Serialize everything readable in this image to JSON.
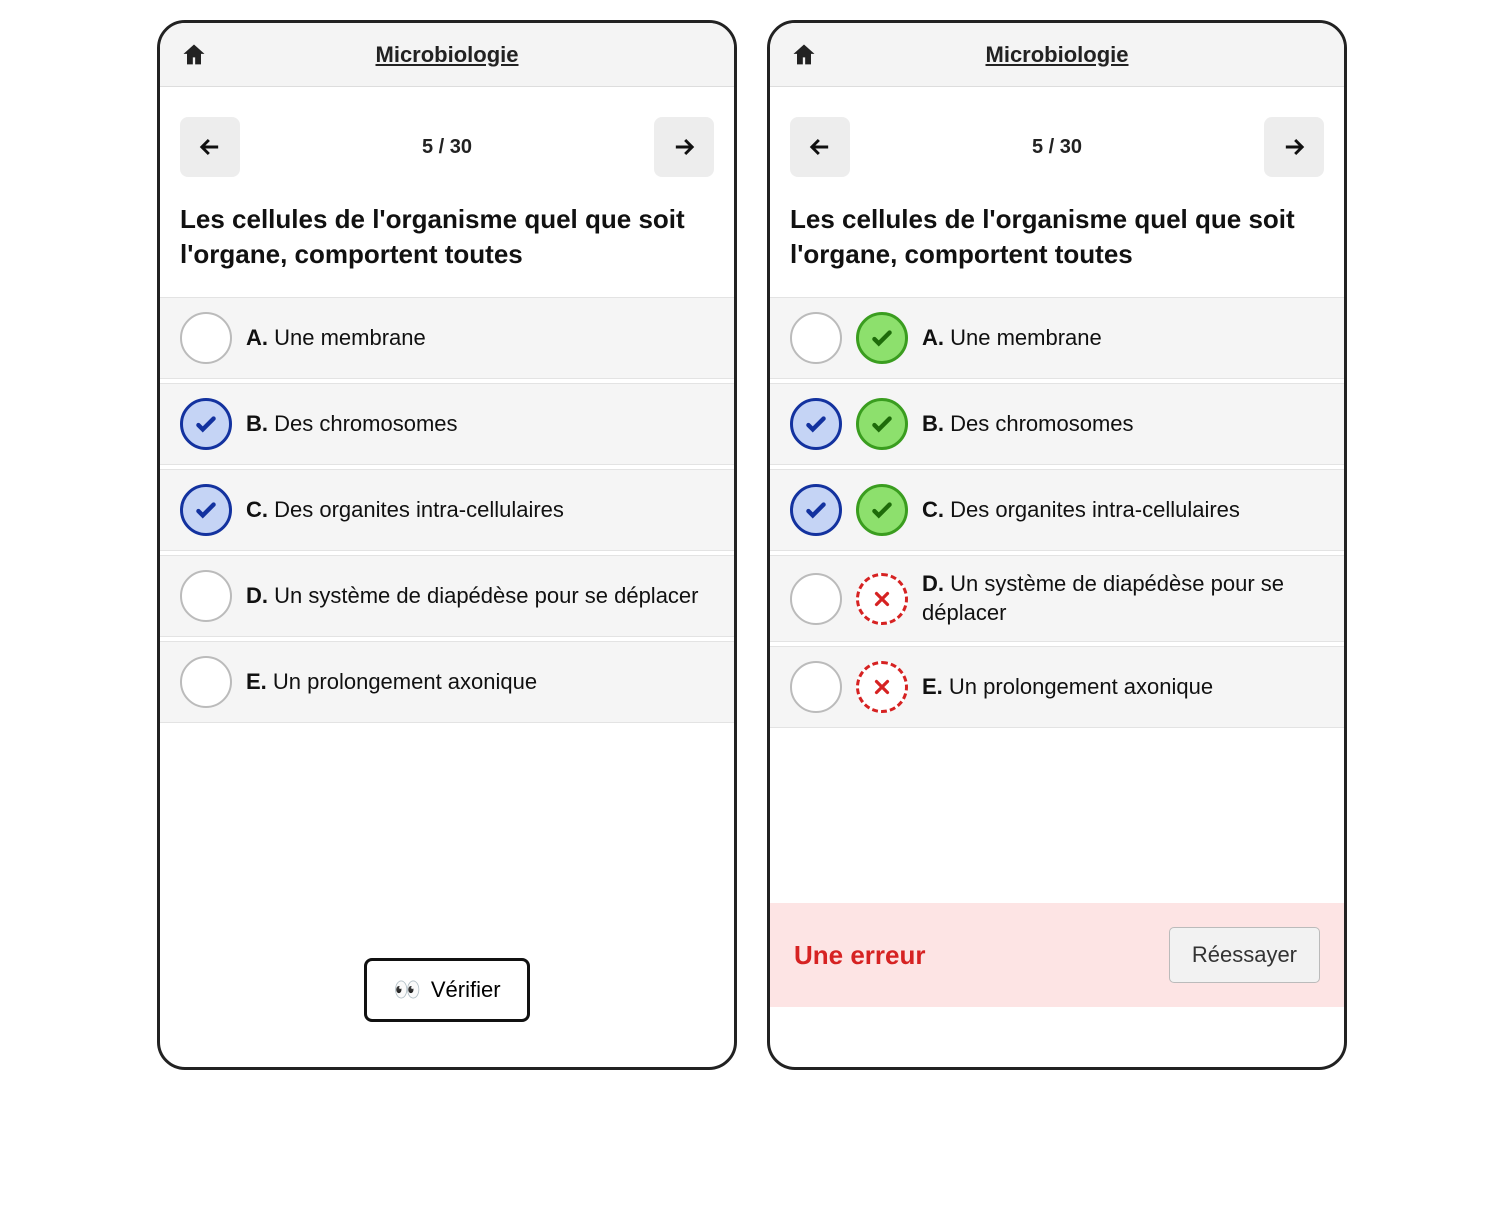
{
  "header": {
    "title": "Microbiologie"
  },
  "nav": {
    "counter": "5 / 30"
  },
  "question": "Les cellules de l'organisme quel que soit l'organe, comportent toutes",
  "options": [
    {
      "letter": "A.",
      "text": "Une membrane",
      "selected": false,
      "correct": true
    },
    {
      "letter": "B.",
      "text": "Des chromosomes",
      "selected": true,
      "correct": true
    },
    {
      "letter": "C.",
      "text": "Des organites intra-cellulaires",
      "selected": true,
      "correct": true
    },
    {
      "letter": "D.",
      "text": "Un système de diapédèse pour se déplacer",
      "selected": false,
      "correct": false
    },
    {
      "letter": "E.",
      "text": "Un prolongement axonique",
      "selected": false,
      "correct": false
    }
  ],
  "buttons": {
    "verify": "Vérifier",
    "verify_emoji": "👀",
    "retry": "Réessayer"
  },
  "result": {
    "error_text": "Une erreur"
  }
}
